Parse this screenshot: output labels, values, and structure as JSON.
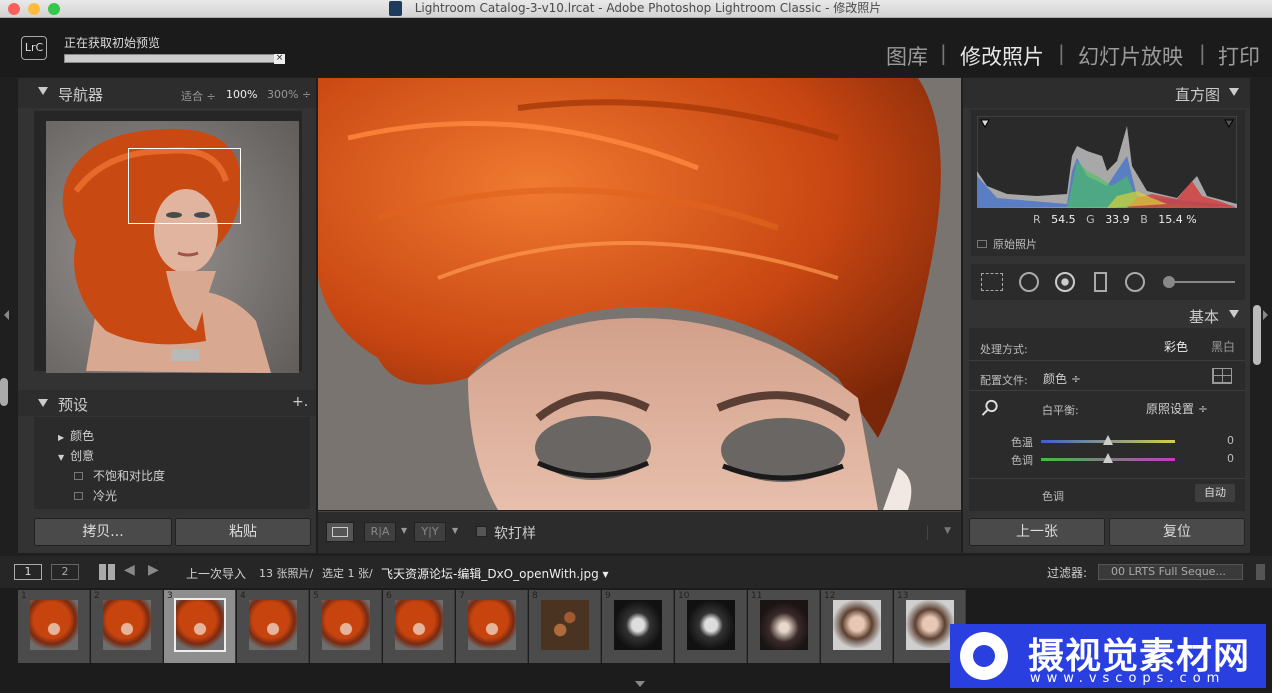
{
  "window": {
    "title": "Lightroom Catalog-3-v10.lrcat - Adobe Photoshop Lightroom Classic - 修改照片"
  },
  "header": {
    "logo": "LrC",
    "status_text": "正在获取初始预览",
    "modules": [
      "图库",
      "修改照片",
      "幻灯片放映",
      "打印"
    ],
    "active_module": "修改照片",
    "separator": "|"
  },
  "navigator": {
    "title": "导航器",
    "zoom_fit": "适合 ÷",
    "zoom_100": "100%",
    "zoom_300": "300% ÷"
  },
  "presets": {
    "title": "预设",
    "add_icon": "+.",
    "groups": [
      {
        "label": "颜色",
        "expanded": false
      },
      {
        "label": "创意",
        "expanded": true
      }
    ],
    "items": [
      "不饱和对比度",
      "冷光"
    ]
  },
  "left_buttons": {
    "copy": "拷贝...",
    "paste": "粘贴"
  },
  "toolbar": {
    "soft_proof": "软打样"
  },
  "histogram": {
    "title": "直方图",
    "r_label": "R",
    "r_value": "54.5",
    "g_label": "G",
    "g_value": "33.9",
    "b_label": "B",
    "b_value": "15.4 %",
    "original_photo": "原始照片"
  },
  "basic": {
    "title": "基本",
    "treatment_label": "处理方式:",
    "treatment_color": "彩色",
    "treatment_bw": "黑白",
    "profile_label": "配置文件:",
    "profile_value": "颜色 ÷",
    "wb_label": "白平衡:",
    "wb_value": "原照设置 ÷",
    "temp_label": "色温",
    "temp_value": "0",
    "tint_label": "色调",
    "tint_value": "0",
    "tone_label": "色调",
    "tone_auto": "自动"
  },
  "right_buttons": {
    "previous": "上一张",
    "reset": "复位"
  },
  "filmstrip_bar": {
    "view1": "1",
    "view2": "2",
    "source": "上一次导入",
    "count": "13 张照片/",
    "selected": "选定 1 张/",
    "filename": "飞天资源论坛-编辑_DxO_openWith.jpg ▾",
    "filter_label": "过滤器:",
    "filter_value": "00 LRTS Full Seque..."
  },
  "filmstrip": {
    "selected_index": 3,
    "items": [
      {
        "num": "1",
        "kind": "hair"
      },
      {
        "num": "2",
        "kind": "hair"
      },
      {
        "num": "3",
        "kind": "hair"
      },
      {
        "num": "4",
        "kind": "hair"
      },
      {
        "num": "5",
        "kind": "hair"
      },
      {
        "num": "6",
        "kind": "hair"
      },
      {
        "num": "7",
        "kind": "hair"
      },
      {
        "num": "8",
        "kind": "wood"
      },
      {
        "num": "9",
        "kind": "bw"
      },
      {
        "num": "10",
        "kind": "bw"
      },
      {
        "num": "11",
        "kind": "dark"
      },
      {
        "num": "12",
        "kind": "portrait"
      },
      {
        "num": "13",
        "kind": "portrait"
      }
    ]
  },
  "watermark": {
    "text": "摄视觉素材网",
    "url": "www.vscops.com"
  },
  "colors": {
    "accent": "#2a3fe0",
    "panel": "#333333",
    "background": "#1f1f1f"
  }
}
